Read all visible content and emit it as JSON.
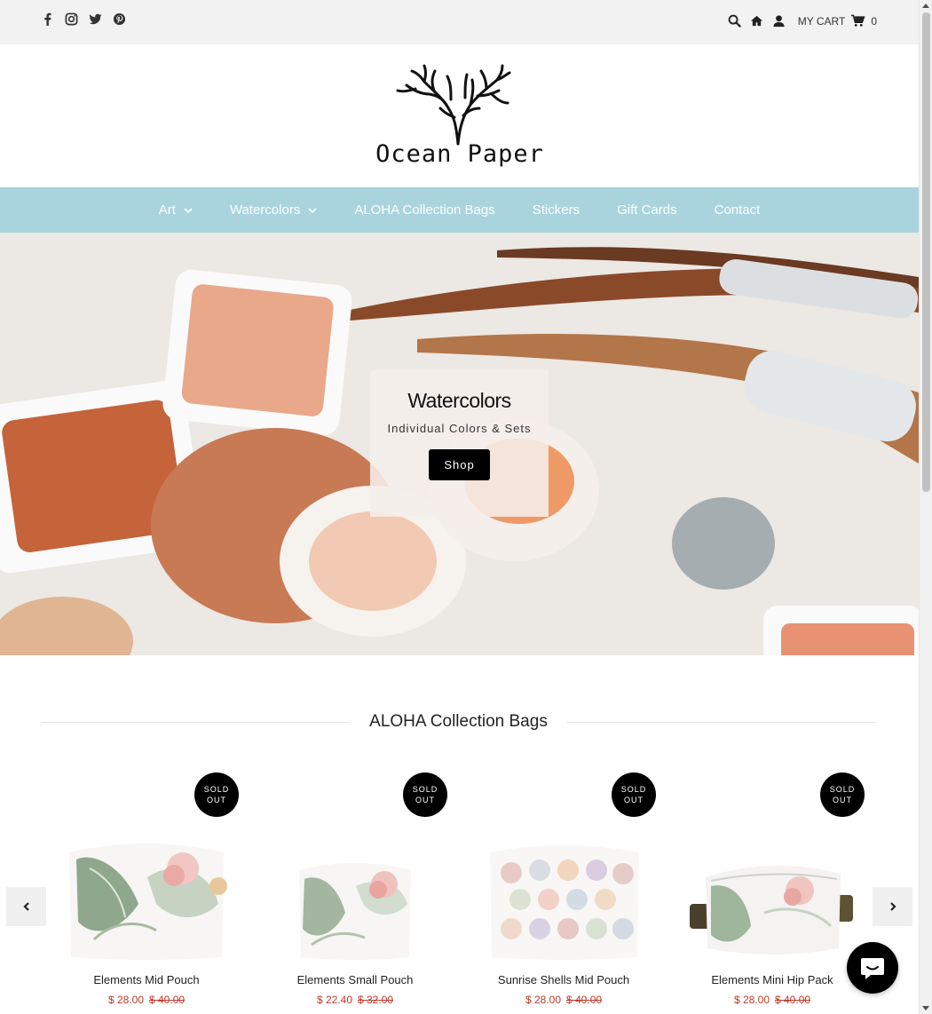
{
  "topbar": {
    "social": [
      "facebook-icon",
      "instagram-icon",
      "twitter-icon",
      "pinterest-icon"
    ],
    "cart_label": "MY CART",
    "cart_count": "0"
  },
  "logo": {
    "text": "Ocean Paper"
  },
  "nav": {
    "items": [
      {
        "label": "Art",
        "has_dropdown": true
      },
      {
        "label": "Watercolors",
        "has_dropdown": true
      },
      {
        "label": "ALOHA Collection Bags",
        "has_dropdown": false
      },
      {
        "label": "Stickers",
        "has_dropdown": false
      },
      {
        "label": "Gift Cards",
        "has_dropdown": false
      },
      {
        "label": "Contact",
        "has_dropdown": false
      }
    ],
    "color": "#a9d4de"
  },
  "hero": {
    "title": "Watercolors",
    "subtitle": "Individual Colors & Sets",
    "button": "Shop"
  },
  "section": {
    "title": "ALOHA Collection Bags",
    "products": [
      {
        "name": "Elements Mid Pouch",
        "price": "$ 28.00",
        "old_price": "$ 40.00",
        "badge": [
          "SOLD",
          "OUT"
        ]
      },
      {
        "name": "Elements Small Pouch",
        "price": "$ 22.40",
        "old_price": "$ 32.00",
        "badge": [
          "SOLD",
          "OUT"
        ]
      },
      {
        "name": "Sunrise Shells Mid Pouch",
        "price": "$ 28.00",
        "old_price": "$ 40.00",
        "badge": [
          "SOLD",
          "OUT"
        ]
      },
      {
        "name": "Elements Mini Hip Pack",
        "price": "$ 28.00",
        "old_price": "$ 40.00",
        "badge": [
          "SOLD",
          "OUT"
        ]
      }
    ]
  }
}
